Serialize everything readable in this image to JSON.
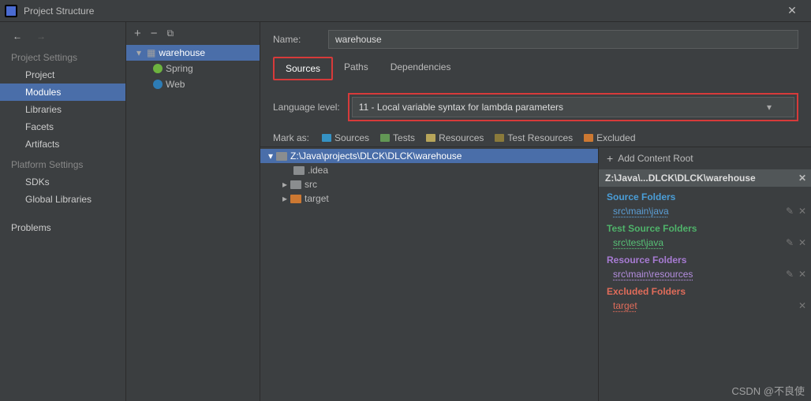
{
  "window": {
    "title": "Project Structure"
  },
  "nav": {
    "settings_label": "Project Settings",
    "items": {
      "project": "Project",
      "modules": "Modules",
      "libraries": "Libraries",
      "facets": "Facets",
      "artifacts": "Artifacts"
    },
    "platform_label": "Platform Settings",
    "platform_items": {
      "sdks": "SDKs",
      "global_libs": "Global Libraries"
    },
    "problems": "Problems"
  },
  "module_tree": {
    "root": "warehouse",
    "children": {
      "spring": "Spring",
      "web": "Web"
    }
  },
  "form": {
    "name_label": "Name:",
    "name_value": "warehouse",
    "tabs": {
      "sources": "Sources",
      "paths": "Paths",
      "deps": "Dependencies"
    },
    "lang_label": "Language level:",
    "lang_value": "11 - Local variable syntax for lambda parameters",
    "mark_label": "Mark as:",
    "mark": {
      "sources": "Sources",
      "tests": "Tests",
      "resources": "Resources",
      "test_res": "Test Resources",
      "excluded": "Excluded"
    }
  },
  "tree": {
    "root": "Z:\\Java\\projects\\DLCK\\DLCK\\warehouse",
    "idea": ".idea",
    "src": "src",
    "target": "target"
  },
  "side": {
    "add": "Add Content Root",
    "path": "Z:\\Java\\...DLCK\\DLCK\\warehouse",
    "source_title": "Source Folders",
    "source_item": "src\\main\\java",
    "test_title": "Test Source Folders",
    "test_item": "src\\test\\java",
    "res_title": "Resource Folders",
    "res_item": "src\\main\\resources",
    "excl_title": "Excluded Folders",
    "excl_item": "target"
  },
  "watermark": "CSDN @不良使"
}
